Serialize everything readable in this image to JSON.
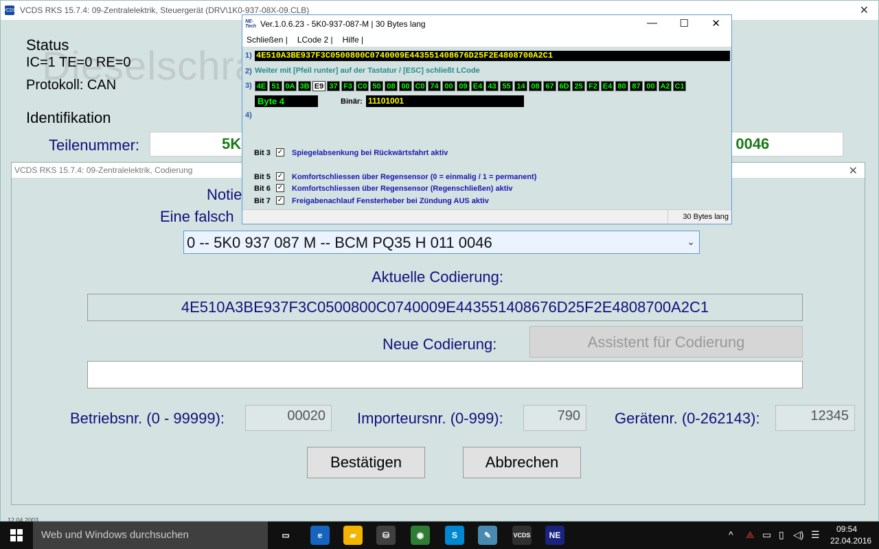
{
  "main": {
    "title": "VCDS RKS 15.7.4: 09-Zentralelektrik,  Steuergerät (DRV\\1K0-937-08X-09.CLB)",
    "app_icon": "VCDS",
    "close": "✕",
    "status_title": "Status",
    "status_line": "IC=1  TE=0   RE=0",
    "protocol": "Protokoll: CAN",
    "ident_title": "Identifikation",
    "teil_label": "Teilenummer:",
    "teil_value_left": "5K",
    "teil_value_right": "1 0046",
    "date_stub": "12.04.2003",
    "watermark": "Dieselschrauber Community"
  },
  "coding": {
    "title": "VCDS RKS 15.7.4: 09-Zentralelektrik,  Codierung",
    "close": "✕",
    "notice_1": "Notie",
    "notice_2": "Eine falsch",
    "select_value": "0 -- 5K0 937 087 M -- BCM PQ35 H     011 0046",
    "chevron": "⌄",
    "aktuell_label": "Aktuelle Codierung:",
    "aktuell_value": "4E510A3BE937F3C0500800C0740009E443551408676D25F2E4808700A2C1",
    "neu_label": "Neue Codierung:",
    "neu_value": "",
    "assistent_label": "Assistent für Codierung",
    "betrieb_label": "Betriebsnr. (0 - 99999):",
    "betrieb_value": "00020",
    "importeur_label": "Importeursnr. (0-999):",
    "importeur_value": "790",
    "geraet_label": "Gerätenr. (0-262143):",
    "geraet_value": "12345",
    "confirm_label": "Bestätigen",
    "cancel_label": "Abbrechen"
  },
  "netech": {
    "logo": "NE-Tech",
    "title": "Ver.1.0.6.23 -    5K0-937-087-M | 30 Bytes lang",
    "min": "—",
    "max": "☐",
    "close": "✕",
    "menu": [
      "Schließen |",
      "LCode 2 |",
      "Hilfe |"
    ],
    "row1_num": "1)",
    "row1_value": "4E510A3BE937F3C0500800C0740009E443551408676D25F2E4808700A2C1",
    "row2_num": "2)",
    "row2_text": "Weiter mit [Pfeil runter] auf der Tastatur / [ESC] schließt LCode",
    "row3_num": "3)",
    "bytes": [
      "4E",
      "51",
      "0A",
      "3B",
      "E9",
      "37",
      "F3",
      "C0",
      "50",
      "08",
      "00",
      "C0",
      "74",
      "00",
      "09",
      "E4",
      "43",
      "55",
      "14",
      "08",
      "67",
      "6D",
      "25",
      "F2",
      "E4",
      "80",
      "87",
      "00",
      "A2",
      "C1"
    ],
    "selected_byte_index": 4,
    "row4_num": "4)",
    "byte_label": "Byte 4",
    "binaer_label": "Binär:",
    "binaer_value": "11101001",
    "bits": [
      {
        "label": "Bit 3",
        "checked": true,
        "check": "✓",
        "desc": "Spiegelabsenkung bei Rückwärtsfahrt aktiv"
      },
      {
        "label": "Bit 5",
        "checked": true,
        "check": "✓",
        "desc": "Komfortschliessen über Regensensor (0 = einmalig / 1 = permanent)"
      },
      {
        "label": "Bit 6",
        "checked": true,
        "check": "✓",
        "desc": "Komfortschliessen über Regensensor (Regenschließen) aktiv"
      },
      {
        "label": "Bit 7",
        "checked": true,
        "check": "✓",
        "desc": "Freigabenachlauf Fensterheber bei Zündung AUS aktiv"
      }
    ],
    "status_right": "30 Bytes lang"
  },
  "taskbar": {
    "search_placeholder": "Web und Windows durchsuchen",
    "apps": [
      {
        "icon": "task-view-icon",
        "glyph": "▭",
        "color": "#101010"
      },
      {
        "icon": "edge-icon",
        "glyph": "e",
        "color": "#1565c0"
      },
      {
        "icon": "explorer-icon",
        "glyph": "▰",
        "color": "#f5b400"
      },
      {
        "icon": "store-icon",
        "glyph": "⛁",
        "color": "#404040"
      },
      {
        "icon": "chrome-icon",
        "glyph": "◉",
        "color": "#2e7d32"
      },
      {
        "icon": "skype-icon",
        "glyph": "S",
        "color": "#0288d1"
      },
      {
        "icon": "notepad-icon",
        "glyph": "✎",
        "color": "#4a8ab0"
      },
      {
        "icon": "vcds-icon",
        "glyph": "VCDS",
        "color": "#303030"
      },
      {
        "icon": "netech-icon",
        "glyph": "NE",
        "color": "#1a237e"
      }
    ],
    "tray": {
      "chevron": "^",
      "acrobat": "⟁",
      "battery": "▭",
      "network": "▯",
      "volume": "◁)",
      "notifications": "☰"
    },
    "clock_time": "09:54",
    "clock_date": "22.04.2016"
  },
  "colors": {
    "navy_text": "#10107a",
    "green_value": "#1a7a1a",
    "byte_green": "#00ff00",
    "byte_yellow": "#ffff00"
  }
}
